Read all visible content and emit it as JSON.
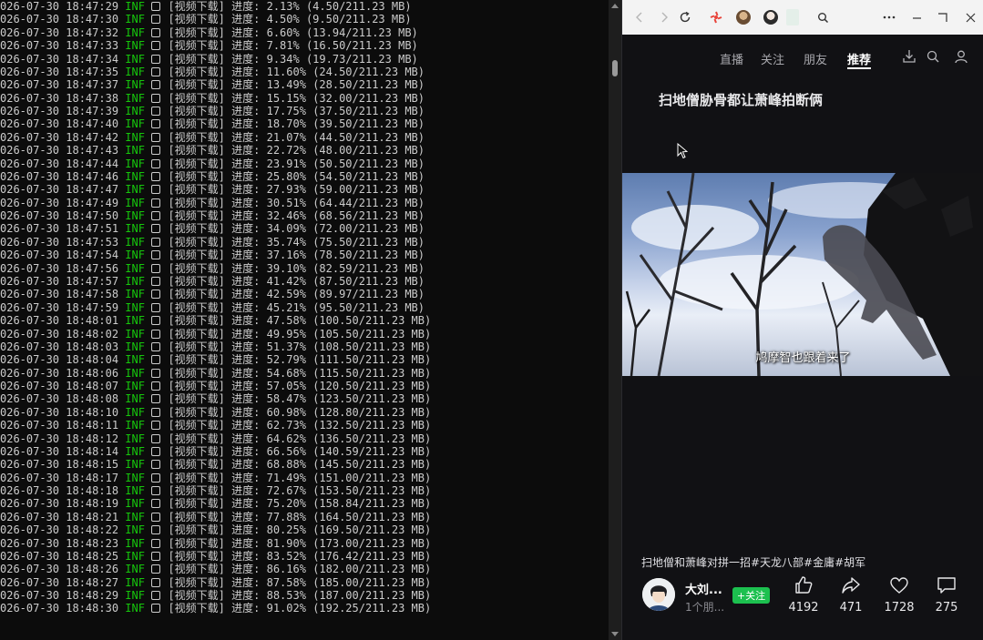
{
  "terminal": {
    "lines": [
      {
        "time": "026-07-30 18:47:29",
        "level": "INF",
        "tag": "[视频下载]",
        "label": "进度:",
        "percent": "2.13%",
        "size": "(4.50/211.23 MB)"
      },
      {
        "time": "026-07-30 18:47:30",
        "level": "INF",
        "tag": "[视频下载]",
        "label": "进度:",
        "percent": "4.50%",
        "size": "(9.50/211.23 MB)"
      },
      {
        "time": "026-07-30 18:47:32",
        "level": "INF",
        "tag": "[视频下载]",
        "label": "进度:",
        "percent": "6.60%",
        "size": "(13.94/211.23 MB)"
      },
      {
        "time": "026-07-30 18:47:33",
        "level": "INF",
        "tag": "[视频下载]",
        "label": "进度:",
        "percent": "7.81%",
        "size": "(16.50/211.23 MB)"
      },
      {
        "time": "026-07-30 18:47:34",
        "level": "INF",
        "tag": "[视频下载]",
        "label": "进度:",
        "percent": "9.34%",
        "size": "(19.73/211.23 MB)"
      },
      {
        "time": "026-07-30 18:47:35",
        "level": "INF",
        "tag": "[视频下载]",
        "label": "进度:",
        "percent": "11.60%",
        "size": "(24.50/211.23 MB)"
      },
      {
        "time": "026-07-30 18:47:37",
        "level": "INF",
        "tag": "[视频下载]",
        "label": "进度:",
        "percent": "13.49%",
        "size": "(28.50/211.23 MB)"
      },
      {
        "time": "026-07-30 18:47:38",
        "level": "INF",
        "tag": "[视频下载]",
        "label": "进度:",
        "percent": "15.15%",
        "size": "(32.00/211.23 MB)"
      },
      {
        "time": "026-07-30 18:47:39",
        "level": "INF",
        "tag": "[视频下载]",
        "label": "进度:",
        "percent": "17.75%",
        "size": "(37.50/211.23 MB)"
      },
      {
        "time": "026-07-30 18:47:40",
        "level": "INF",
        "tag": "[视频下载]",
        "label": "进度:",
        "percent": "18.70%",
        "size": "(39.50/211.23 MB)"
      },
      {
        "time": "026-07-30 18:47:42",
        "level": "INF",
        "tag": "[视频下载]",
        "label": "进度:",
        "percent": "21.07%",
        "size": "(44.50/211.23 MB)"
      },
      {
        "time": "026-07-30 18:47:43",
        "level": "INF",
        "tag": "[视频下载]",
        "label": "进度:",
        "percent": "22.72%",
        "size": "(48.00/211.23 MB)"
      },
      {
        "time": "026-07-30 18:47:44",
        "level": "INF",
        "tag": "[视频下载]",
        "label": "进度:",
        "percent": "23.91%",
        "size": "(50.50/211.23 MB)"
      },
      {
        "time": "026-07-30 18:47:46",
        "level": "INF",
        "tag": "[视频下载]",
        "label": "进度:",
        "percent": "25.80%",
        "size": "(54.50/211.23 MB)"
      },
      {
        "time": "026-07-30 18:47:47",
        "level": "INF",
        "tag": "[视频下载]",
        "label": "进度:",
        "percent": "27.93%",
        "size": "(59.00/211.23 MB)"
      },
      {
        "time": "026-07-30 18:47:49",
        "level": "INF",
        "tag": "[视频下载]",
        "label": "进度:",
        "percent": "30.51%",
        "size": "(64.44/211.23 MB)"
      },
      {
        "time": "026-07-30 18:47:50",
        "level": "INF",
        "tag": "[视频下载]",
        "label": "进度:",
        "percent": "32.46%",
        "size": "(68.56/211.23 MB)"
      },
      {
        "time": "026-07-30 18:47:51",
        "level": "INF",
        "tag": "[视频下载]",
        "label": "进度:",
        "percent": "34.09%",
        "size": "(72.00/211.23 MB)"
      },
      {
        "time": "026-07-30 18:47:53",
        "level": "INF",
        "tag": "[视频下载]",
        "label": "进度:",
        "percent": "35.74%",
        "size": "(75.50/211.23 MB)"
      },
      {
        "time": "026-07-30 18:47:54",
        "level": "INF",
        "tag": "[视频下载]",
        "label": "进度:",
        "percent": "37.16%",
        "size": "(78.50/211.23 MB)"
      },
      {
        "time": "026-07-30 18:47:56",
        "level": "INF",
        "tag": "[视频下载]",
        "label": "进度:",
        "percent": "39.10%",
        "size": "(82.59/211.23 MB)"
      },
      {
        "time": "026-07-30 18:47:57",
        "level": "INF",
        "tag": "[视频下载]",
        "label": "进度:",
        "percent": "41.42%",
        "size": "(87.50/211.23 MB)"
      },
      {
        "time": "026-07-30 18:47:58",
        "level": "INF",
        "tag": "[视频下载]",
        "label": "进度:",
        "percent": "42.59%",
        "size": "(89.97/211.23 MB)"
      },
      {
        "time": "026-07-30 18:47:59",
        "level": "INF",
        "tag": "[视频下载]",
        "label": "进度:",
        "percent": "45.21%",
        "size": "(95.50/211.23 MB)"
      },
      {
        "time": "026-07-30 18:48:01",
        "level": "INF",
        "tag": "[视频下载]",
        "label": "进度:",
        "percent": "47.58%",
        "size": "(100.50/211.23 MB)"
      },
      {
        "time": "026-07-30 18:48:02",
        "level": "INF",
        "tag": "[视频下载]",
        "label": "进度:",
        "percent": "49.95%",
        "size": "(105.50/211.23 MB)"
      },
      {
        "time": "026-07-30 18:48:03",
        "level": "INF",
        "tag": "[视频下载]",
        "label": "进度:",
        "percent": "51.37%",
        "size": "(108.50/211.23 MB)"
      },
      {
        "time": "026-07-30 18:48:04",
        "level": "INF",
        "tag": "[视频下载]",
        "label": "进度:",
        "percent": "52.79%",
        "size": "(111.50/211.23 MB)"
      },
      {
        "time": "026-07-30 18:48:06",
        "level": "INF",
        "tag": "[视频下载]",
        "label": "进度:",
        "percent": "54.68%",
        "size": "(115.50/211.23 MB)"
      },
      {
        "time": "026-07-30 18:48:07",
        "level": "INF",
        "tag": "[视频下载]",
        "label": "进度:",
        "percent": "57.05%",
        "size": "(120.50/211.23 MB)"
      },
      {
        "time": "026-07-30 18:48:08",
        "level": "INF",
        "tag": "[视频下载]",
        "label": "进度:",
        "percent": "58.47%",
        "size": "(123.50/211.23 MB)"
      },
      {
        "time": "026-07-30 18:48:10",
        "level": "INF",
        "tag": "[视频下载]",
        "label": "进度:",
        "percent": "60.98%",
        "size": "(128.80/211.23 MB)"
      },
      {
        "time": "026-07-30 18:48:11",
        "level": "INF",
        "tag": "[视频下载]",
        "label": "进度:",
        "percent": "62.73%",
        "size": "(132.50/211.23 MB)"
      },
      {
        "time": "026-07-30 18:48:12",
        "level": "INF",
        "tag": "[视频下载]",
        "label": "进度:",
        "percent": "64.62%",
        "size": "(136.50/211.23 MB)"
      },
      {
        "time": "026-07-30 18:48:14",
        "level": "INF",
        "tag": "[视频下载]",
        "label": "进度:",
        "percent": "66.56%",
        "size": "(140.59/211.23 MB)"
      },
      {
        "time": "026-07-30 18:48:15",
        "level": "INF",
        "tag": "[视频下载]",
        "label": "进度:",
        "percent": "68.88%",
        "size": "(145.50/211.23 MB)"
      },
      {
        "time": "026-07-30 18:48:17",
        "level": "INF",
        "tag": "[视频下载]",
        "label": "进度:",
        "percent": "71.49%",
        "size": "(151.00/211.23 MB)"
      },
      {
        "time": "026-07-30 18:48:18",
        "level": "INF",
        "tag": "[视频下载]",
        "label": "进度:",
        "percent": "72.67%",
        "size": "(153.50/211.23 MB)"
      },
      {
        "time": "026-07-30 18:48:19",
        "level": "INF",
        "tag": "[视频下载]",
        "label": "进度:",
        "percent": "75.20%",
        "size": "(158.84/211.23 MB)"
      },
      {
        "time": "026-07-30 18:48:21",
        "level": "INF",
        "tag": "[视频下载]",
        "label": "进度:",
        "percent": "77.88%",
        "size": "(164.50/211.23 MB)"
      },
      {
        "time": "026-07-30 18:48:22",
        "level": "INF",
        "tag": "[视频下载]",
        "label": "进度:",
        "percent": "80.25%",
        "size": "(169.50/211.23 MB)"
      },
      {
        "time": "026-07-30 18:48:23",
        "level": "INF",
        "tag": "[视频下载]",
        "label": "进度:",
        "percent": "81.90%",
        "size": "(173.00/211.23 MB)"
      },
      {
        "time": "026-07-30 18:48:25",
        "level": "INF",
        "tag": "[视频下载]",
        "label": "进度:",
        "percent": "83.52%",
        "size": "(176.42/211.23 MB)"
      },
      {
        "time": "026-07-30 18:48:26",
        "level": "INF",
        "tag": "[视频下载]",
        "label": "进度:",
        "percent": "86.16%",
        "size": "(182.00/211.23 MB)"
      },
      {
        "time": "026-07-30 18:48:27",
        "level": "INF",
        "tag": "[视频下载]",
        "label": "进度:",
        "percent": "87.58%",
        "size": "(185.00/211.23 MB)"
      },
      {
        "time": "026-07-30 18:48:29",
        "level": "INF",
        "tag": "[视频下载]",
        "label": "进度:",
        "percent": "88.53%",
        "size": "(187.00/211.23 MB)"
      },
      {
        "time": "026-07-30 18:48:30",
        "level": "INF",
        "tag": "[视频下载]",
        "label": "进度:",
        "percent": "91.02%",
        "size": "(192.25/211.23 MB)"
      }
    ],
    "colors": {
      "background": "#0c0c0c",
      "text": "#cccccc",
      "level": "#16c60c"
    }
  },
  "browser": {
    "toolbar_icons": [
      "back-icon",
      "forward-icon",
      "refresh-icon",
      "pinwheel-icon",
      "profile-avatar-1",
      "profile-avatar-2",
      "search-icon",
      "more-icon",
      "minimize-icon",
      "maximize-icon",
      "close-icon"
    ],
    "nav": {
      "items": [
        "直播",
        "关注",
        "朋友",
        "推荐"
      ],
      "active": "推荐",
      "icons": [
        "download-icon",
        "search-icon",
        "user-icon"
      ]
    },
    "video": {
      "title": "扫地僧胁骨都让萧峰拍断俩",
      "subtitle": "鸠摩智也跟着来了"
    },
    "caption": "扫地僧和萧峰对拼一招#天龙八部#金庸#胡军",
    "author": {
      "name": "大刘...",
      "sub": "1个朋...",
      "follow_label": "+关注"
    },
    "actions": [
      {
        "icon": "like-icon",
        "count": "4192"
      },
      {
        "icon": "share-icon",
        "count": "471"
      },
      {
        "icon": "favorite-icon",
        "count": "1728"
      },
      {
        "icon": "comment-icon",
        "count": "275"
      }
    ],
    "colors": {
      "background": "#111114",
      "follow": "#1cc04f",
      "titlebar": "#f3f3f3"
    }
  }
}
